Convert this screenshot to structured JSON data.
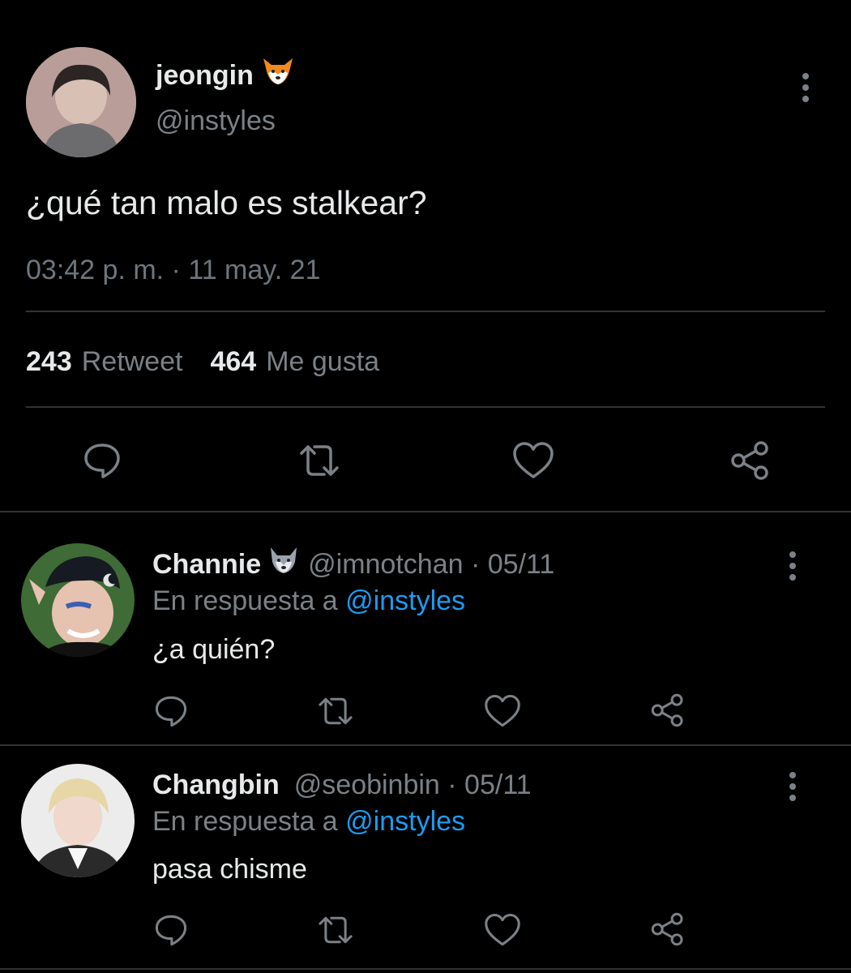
{
  "main_tweet": {
    "display_name": "jeongin",
    "name_emoji": "fox-emoji",
    "handle": "@instyles",
    "text": "¿qué tan malo es stalkear?",
    "timestamp": "03:42 p. m. · 11 may. 21",
    "stats": {
      "retweets_count": "243",
      "retweets_label": "Retweet",
      "likes_count": "464",
      "likes_label": "Me gusta"
    }
  },
  "replies": [
    {
      "display_name": "Channie",
      "name_emoji": "wolf-emoji",
      "handle_date": "@imnotchan · 05/11",
      "reply_prefix": "En respuesta a",
      "reply_to": "@instyles",
      "text": "¿a quién?"
    },
    {
      "display_name": "Changbin",
      "handle_date": "@seobinbin · 05/11",
      "reply_prefix": "En respuesta a",
      "reply_to": "@instyles",
      "text": "pasa chisme"
    }
  ],
  "colors": {
    "background": "#000000",
    "text_primary": "#e7e9ea",
    "text_secondary": "#7b8186",
    "mention": "#1d9bf0",
    "divider": "#2f3336"
  },
  "icons": [
    "reply-icon",
    "retweet-icon",
    "like-icon",
    "share-icon",
    "more-options-icon"
  ]
}
